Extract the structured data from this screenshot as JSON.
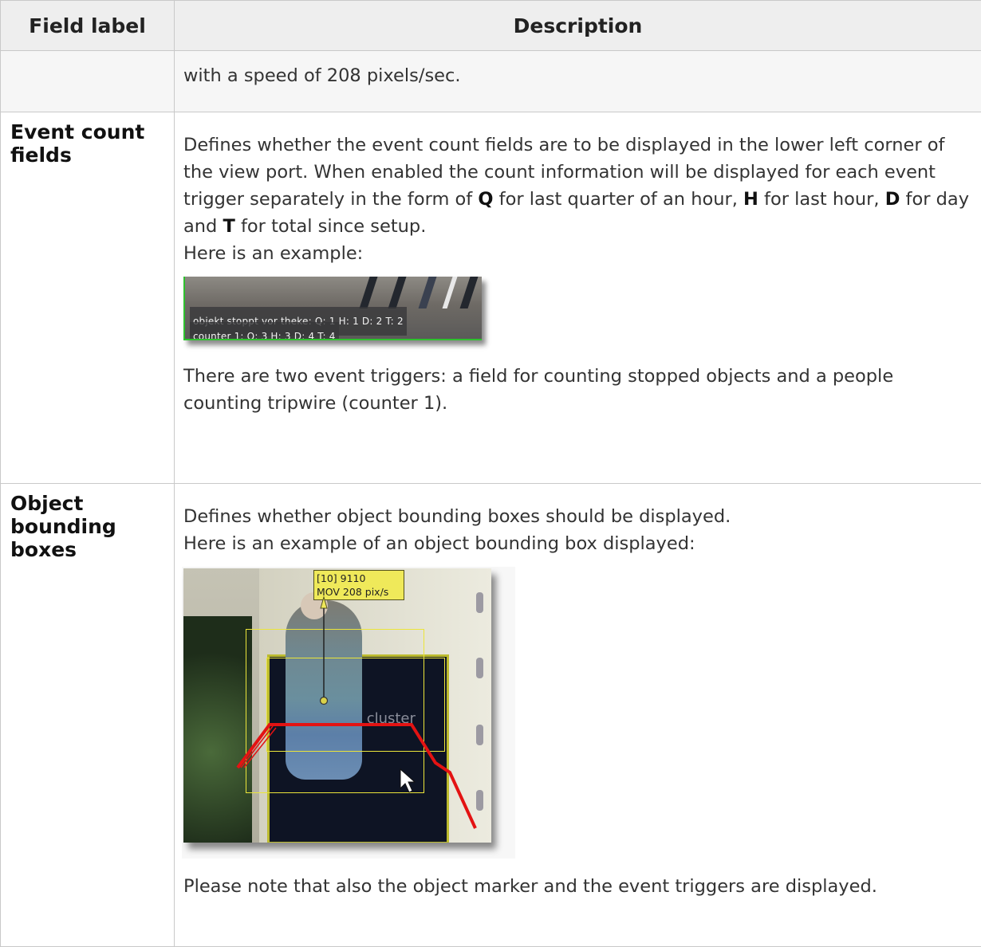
{
  "header": {
    "col_field": "Field label",
    "col_desc": "Description"
  },
  "rows": [
    {
      "label": "",
      "text": "with a speed of 208 pixels/sec."
    },
    {
      "label": "Event count fields",
      "p1": {
        "a": "Defines whether the event count fields are to be displayed in the lower left corner of the view port. When enabled the count information will be displayed for each event trigger separately in the form of ",
        "q": "Q",
        "b": " for last quarter of an hour, ",
        "h": "H",
        "c": " for last hour, ",
        "d": "D",
        "e": " for day and ",
        "t": "T",
        "f": " for total since setup."
      },
      "p2": "Here is an example:",
      "screenshot": {
        "line1": "objekt stoppt vor theke:  Q: 1 H: 1 D: 2 T: 2",
        "line2": "counter 1:  Q: 3 H: 3 D: 4 T: 4"
      },
      "p3": "There are two event triggers: a field for counting stopped objects and a people counting tripwire (counter 1)."
    },
    {
      "label": "Object bounding boxes",
      "p1": "Defines whether object bounding boxes should be displayed.",
      "p2": "Here is an example of an object bounding box displayed:",
      "screenshot": {
        "tag1": "[10] 9110",
        "tag2": "MOV 208 pix/s",
        "mat_text": "ce cluster"
      },
      "p3": "Please note that also the object marker and the event triggers are displayed."
    }
  ],
  "colors": {
    "header_bg": "#eeeeee",
    "border": "#c9c9c9",
    "text": "#333333",
    "tripwire": "#e31313",
    "bbox": "#ece53a",
    "counter_border": "#2ec22e"
  }
}
